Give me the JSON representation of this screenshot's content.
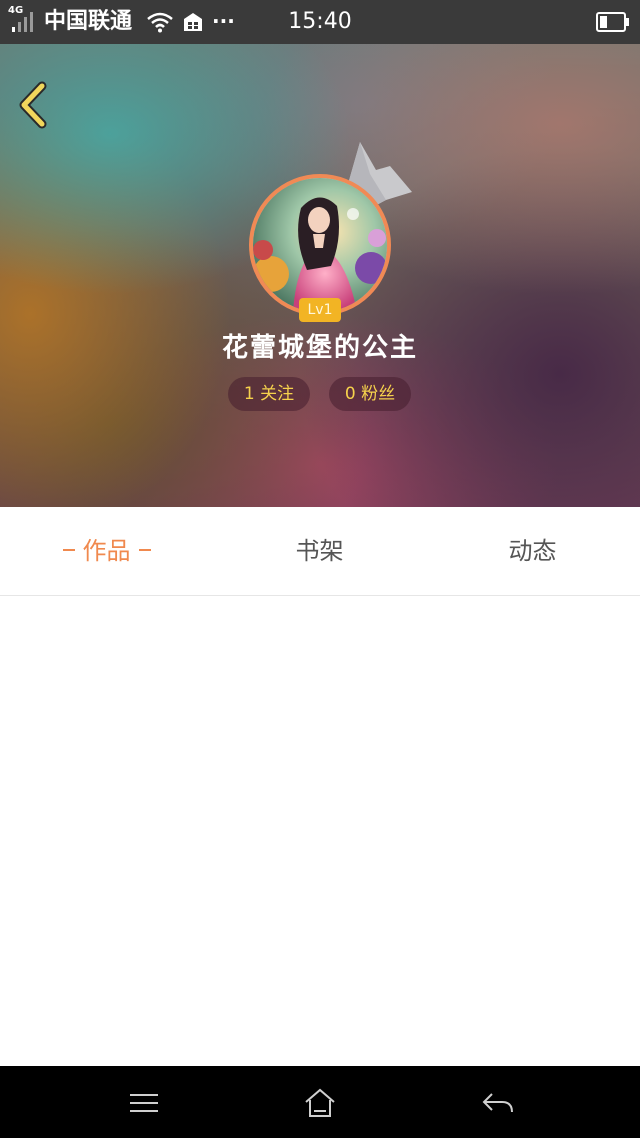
{
  "status_bar": {
    "network": "4G",
    "carrier": "中国联通",
    "more": "···",
    "time": "15:40"
  },
  "profile": {
    "level": "Lv1",
    "name": "花蕾城堡的公主",
    "following": "1 关注",
    "fans": "0 粉丝"
  },
  "tabs": [
    {
      "label": "作品",
      "active": true
    },
    {
      "label": "书架",
      "active": false
    },
    {
      "label": "动态",
      "active": false
    }
  ],
  "colors": {
    "accent": "#f0894e",
    "stat_text": "#f6d24c",
    "level_badge": "#f2b424",
    "back_icon": "#f1d65c"
  },
  "icons": {
    "back": "chevron-left-icon",
    "nav_menu": "menu-icon",
    "nav_home": "home-icon",
    "nav_back": "back-arrow-icon"
  }
}
